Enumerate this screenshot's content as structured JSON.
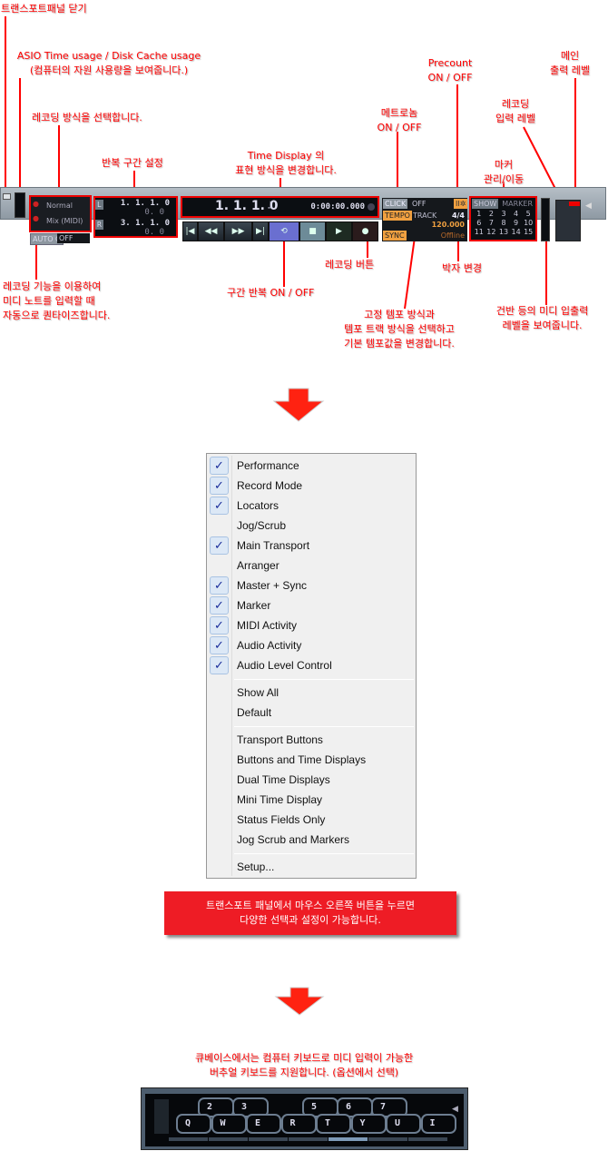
{
  "annotations": {
    "close_panel": "트랜스포트패널 닫기",
    "asio_1": "ASIO Time usage / Disk Cache usage",
    "asio_2": "(컴퓨터의 자원 사용량을 보여줍니다.)",
    "record_mode": "레코딩 방식을 선택합니다.",
    "locators": "반복 구간 설정",
    "time_display_1": "Time Display 의",
    "time_display_2": "표현 방식을 변경합니다.",
    "metronome_1": "메트로놈",
    "metronome_2": "ON / OFF",
    "precount_1": "Precount",
    "precount_2": "ON / OFF",
    "rec_input_1": "레코딩",
    "rec_input_2": "입력 레벨",
    "main_out_1": "메인",
    "main_out_2": "출력 레벨",
    "marker_1": "마커",
    "marker_2": "관리/이동",
    "autoq_1": "레코딩 기능을 이용하여",
    "autoq_2": "미디 노트를 입력할 때",
    "autoq_3": "자동으로 퀀타이즈합니다.",
    "cycle": "구간 반복 ON / OFF",
    "record_button": "레코딩 버튼",
    "tempo_1": "고정 템포 방식과",
    "tempo_2": "템포 트랙 방식을 선택하고",
    "tempo_3": "기본 템포값을 변경합니다.",
    "signature": "박자 변경",
    "midi_1": "건반 등의 미디 입출력",
    "midi_2": "레벨을 보여줍니다.",
    "menu_note_1": "트랜스포트 패널에서 마우스 오른쪽 버튼을 누르면",
    "menu_note_2": "다양한 선택과 설정이 가능합니다.",
    "keyboard_1": "큐베이스에서는 컴퓨터 키보드로 미디 입력이 가능한",
    "keyboard_2": "버추얼 키보드를 지원합니다. (옵션에서 선택)"
  },
  "transport": {
    "record_mode": {
      "linear": "Normal",
      "cycle": "Mix (MIDI)"
    },
    "autoq": {
      "label": "AUTO Q",
      "value": "OFF"
    },
    "locators": {
      "left_label": "L",
      "left": "1. 1. 1.  0",
      "left_sub": "0.  0",
      "right_label": "R",
      "right": "3. 1. 1.  0",
      "right_sub": "0.  0"
    },
    "time_display": {
      "primary": "1.  1.  1.    0",
      "secondary": "0:00:00.000"
    },
    "buttons": [
      "go-to-start",
      "rewind",
      "fast-forward",
      "go-to-end",
      "cycle",
      "stop",
      "play",
      "record"
    ],
    "master": {
      "click_label": "CLICK",
      "click_value": "OFF",
      "tempo_label": "TEMPO",
      "tempo_mode": "TRACK",
      "signature": "4/4",
      "tempo": "120.000",
      "sync_label": "SYNC",
      "sync_value": "Offline"
    },
    "marker": {
      "show": "SHOW",
      "title": "MARKER",
      "numbers": [
        "1",
        "2",
        "3",
        "4",
        "5",
        "6",
        "7",
        "8",
        "9",
        "10",
        "11",
        "12",
        "13",
        "14",
        "15"
      ]
    },
    "colors": {
      "accent": "#f0a040",
      "cycle_active": "#6a6fd0",
      "annotation": "#ff0000"
    }
  },
  "menu": {
    "items": [
      {
        "label": "Performance",
        "checked": true
      },
      {
        "label": "Record Mode",
        "checked": true
      },
      {
        "label": "Locators",
        "checked": true
      },
      {
        "label": "Jog/Scrub",
        "checked": false
      },
      {
        "label": "Main Transport",
        "checked": true
      },
      {
        "label": "Arranger",
        "checked": false
      },
      {
        "label": "Master + Sync",
        "checked": true
      },
      {
        "label": "Marker",
        "checked": true
      },
      {
        "label": "MIDI Activity",
        "checked": true
      },
      {
        "label": "Audio Activity",
        "checked": true
      },
      {
        "label": "Audio Level Control",
        "checked": true
      }
    ],
    "group2": [
      "Show All",
      "Default"
    ],
    "group3": [
      "Transport Buttons",
      "Buttons and Time Displays",
      "Dual Time Displays",
      "Mini Time Display",
      "Status Fields Only",
      "Jog Scrub and Markers"
    ],
    "setup": "Setup..."
  },
  "keyboard": {
    "black_keys": [
      "2",
      "3",
      "5",
      "6",
      "7"
    ],
    "white_keys": [
      "Q",
      "W",
      "E",
      "R",
      "T",
      "Y",
      "U",
      "I"
    ]
  }
}
